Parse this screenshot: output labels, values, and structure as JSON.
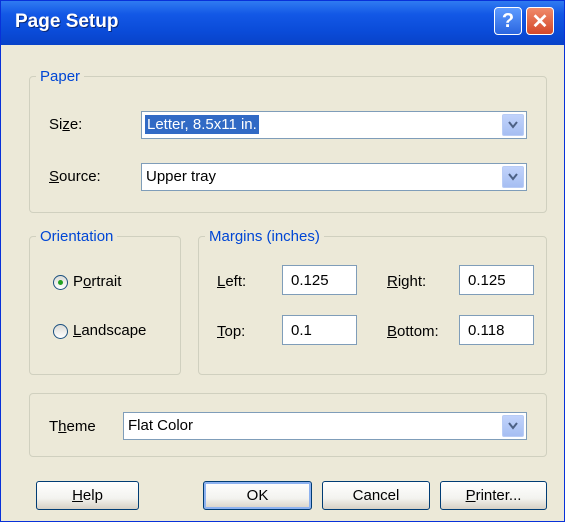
{
  "window": {
    "title": "Page Setup",
    "help_glyph": "?",
    "close_glyph": "✕"
  },
  "paper": {
    "legend": "Paper",
    "size_label_pre": "Si",
    "size_label_u": "z",
    "size_label_post": "e:",
    "size_value": "Letter, 8.5x11 in.",
    "source_label_u": "S",
    "source_label_post": "ource:",
    "source_value": "Upper tray"
  },
  "orientation": {
    "legend": "Orientation",
    "portrait_pre": "P",
    "portrait_u": "o",
    "portrait_post": "rtrait",
    "landscape_pre": "",
    "landscape_u": "L",
    "landscape_post": "andscape",
    "selected": "portrait"
  },
  "margins": {
    "legend": "Margins (inches)",
    "left_label_u": "L",
    "left_label_post": "eft:",
    "left_value": "0.125",
    "right_label_u": "R",
    "right_label_post": "ight:",
    "right_value": "0.125",
    "top_label_u": "T",
    "top_label_post": "op:",
    "top_value": "0.1",
    "bottom_label_u": "B",
    "bottom_label_post": "ottom:",
    "bottom_value": "0.118"
  },
  "theme": {
    "label_pre": "T",
    "label_u": "h",
    "label_post": "eme",
    "value": "Flat Color"
  },
  "buttons": {
    "help_u": "H",
    "help_post": "elp",
    "ok": "OK",
    "cancel": "Cancel",
    "printer_u": "P",
    "printer_post": "rinter..."
  }
}
